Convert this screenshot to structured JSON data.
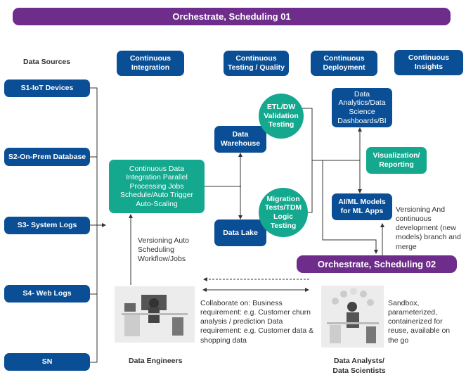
{
  "top_bar": "Orchestrate, Scheduling 01",
  "data_sources_label": "Data Sources",
  "sources": [
    "S1-IoT Devices",
    "S2-On-Prem Database",
    "S3- System Logs",
    "S4- Web Logs",
    "SN"
  ],
  "phases": [
    "Continuous Integration",
    "Continuous Testing / Quality",
    "Continuous Deployment",
    "Continuous Insights"
  ],
  "cdi": "Continuous Data Integration Parallel Processing Jobs Schedule/Auto Trigger Auto-Scaling",
  "warehouse": "Data Warehouse",
  "lake": "Data Lake",
  "etl": "ETL/DW Validation Testing",
  "migration": "Migration Tests/TDM Logic Testing",
  "analytics": "Data Analytics/Data Science Dashboards/BI",
  "visualization": "Visualization/ Reporting",
  "aiml": "AI/ML Models for ML Apps",
  "versioning_models": "Versioning And continuous development (new models) branch and merge",
  "orchestrate2": "Orchestrate, Scheduling 02",
  "versioning_jobs": "Versioning Auto Scheduling Workflow/Jobs",
  "collaborate": "Collaborate on: Business requirement: e.g. Customer churn analysis / prediction Data requirement: e.g. Customer data & shopping data",
  "sandbox": "Sandbox, parameterized, containerized for reuse, available on the go",
  "engineers": "Data Engineers",
  "analysts": "Data Analysts/ Data Scientists",
  "colors": {
    "blue": "#0a4f96",
    "teal": "#14a88e",
    "purple": "#6e2c8b"
  }
}
